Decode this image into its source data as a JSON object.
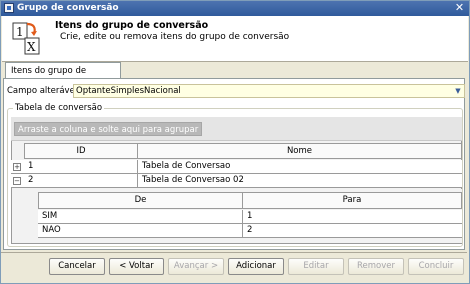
{
  "window": {
    "title": "Grupo de conversão",
    "close_glyph": "✕"
  },
  "header": {
    "title": "Itens do grupo de conversão",
    "subtitle": "Crie, edite ou remova itens do grupo de conversão",
    "icon": "convert-1-to-x-icon",
    "icon_glyph_top": "1",
    "icon_glyph_bottom": "X"
  },
  "tabs": [
    {
      "label": "Itens do grupo de conversão",
      "active": true
    }
  ],
  "form": {
    "field_label": "Campo alterável:",
    "field_value": "OptanteSimplesNacional",
    "dropdown_glyph": "▼"
  },
  "table_group": {
    "legend": "Tabela de conversão",
    "group_hint": "Arraste a coluna e solte aqui para agrupar",
    "columns": [
      "ID",
      "Nome"
    ],
    "rows": [
      {
        "expander": "+",
        "id": "1",
        "nome": "Tabela de Conversao"
      },
      {
        "expander": "−",
        "id": "2",
        "nome": "Tabela de Conversao 02"
      }
    ],
    "detail": {
      "columns": [
        "De",
        "Para"
      ],
      "rows": [
        {
          "de": "SIM",
          "para": "1"
        },
        {
          "de": "NAO",
          "para": "2"
        }
      ]
    }
  },
  "buttons": {
    "cancel": "Cancelar",
    "back": "< Voltar",
    "next": "Avançar >",
    "add": "Adicionar",
    "edit": "Editar",
    "remove": "Remover",
    "finish": "Concluir"
  },
  "colors": {
    "titlebar": "#2f5a9c",
    "field_background": "#ffffe3",
    "group_hint_background": "#b8b8b8"
  }
}
